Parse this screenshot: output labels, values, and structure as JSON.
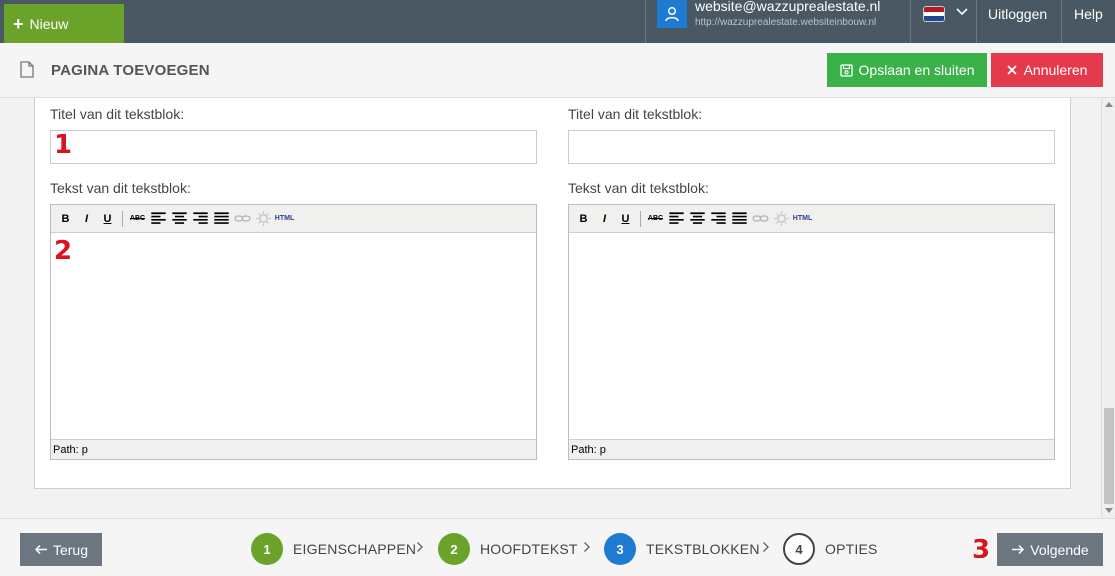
{
  "topbar": {
    "new_label": "Nieuw",
    "user_email": "website@wazzuprealestate.nl",
    "user_url": "http://wazzuprealestate.websiteinbouw.nl",
    "language_flag": "nl-flag-icon",
    "logout_label": "Uitloggen",
    "help_label": "Help",
    "colors": {
      "bar": "#4a5863",
      "new_button": "#6aa22a",
      "avatar": "#1f7bd1"
    }
  },
  "titlebar": {
    "title": "PAGINA TOEVOEGEN",
    "save_label": "Opslaan en sluiten",
    "cancel_label": "Annuleren",
    "colors": {
      "save": "#3bb14a",
      "cancel": "#e43a4b"
    }
  },
  "blocks": [
    {
      "title_label": "Titel van dit tekstblok:",
      "title_value": "",
      "text_label": "Tekst van dit tekstblok:",
      "status_path": "Path: p"
    },
    {
      "title_label": "Titel van dit tekstblok:",
      "title_value": "",
      "text_label": "Tekst van dit tekstblok:",
      "status_path": "Path: p"
    }
  ],
  "editor_toolbar": {
    "bold": "B",
    "italic": "I",
    "underline": "U",
    "strike": "ABC",
    "html": "HTML",
    "icons": [
      "bold-icon",
      "italic-icon",
      "underline-icon",
      "strikethrough-icon",
      "align-left-icon",
      "align-center-icon",
      "align-right-icon",
      "align-justify-icon",
      "link-icon",
      "unlink-icon",
      "html-icon"
    ]
  },
  "annotations": [
    "1",
    "2",
    "3"
  ],
  "footer": {
    "back_label": "Terug",
    "next_label": "Volgende",
    "steps": [
      {
        "number": "1",
        "label": "EIGENSCHAPPEN",
        "color": "#6aa22a"
      },
      {
        "number": "2",
        "label": "HOOFDTEKST",
        "color": "#6aa22a"
      },
      {
        "number": "3",
        "label": "TEKSTBLOKKEN",
        "color": "#1f7bd1"
      },
      {
        "number": "4",
        "label": "OPTIES",
        "color": "#ffffff"
      }
    ]
  }
}
